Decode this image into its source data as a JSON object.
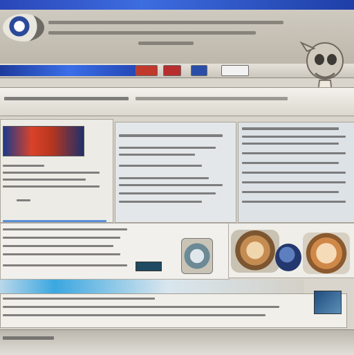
{
  "header": {
    "site_badge": "e",
    "nav_buttons": [
      "",
      "",
      "",
      ""
    ]
  },
  "colors": {
    "accent_blue": "#2a46b8",
    "banner_red": "#d9422a",
    "panel_bg": "#ecebe6"
  },
  "icons": [
    "logo-icon",
    "mascot-icon"
  ]
}
